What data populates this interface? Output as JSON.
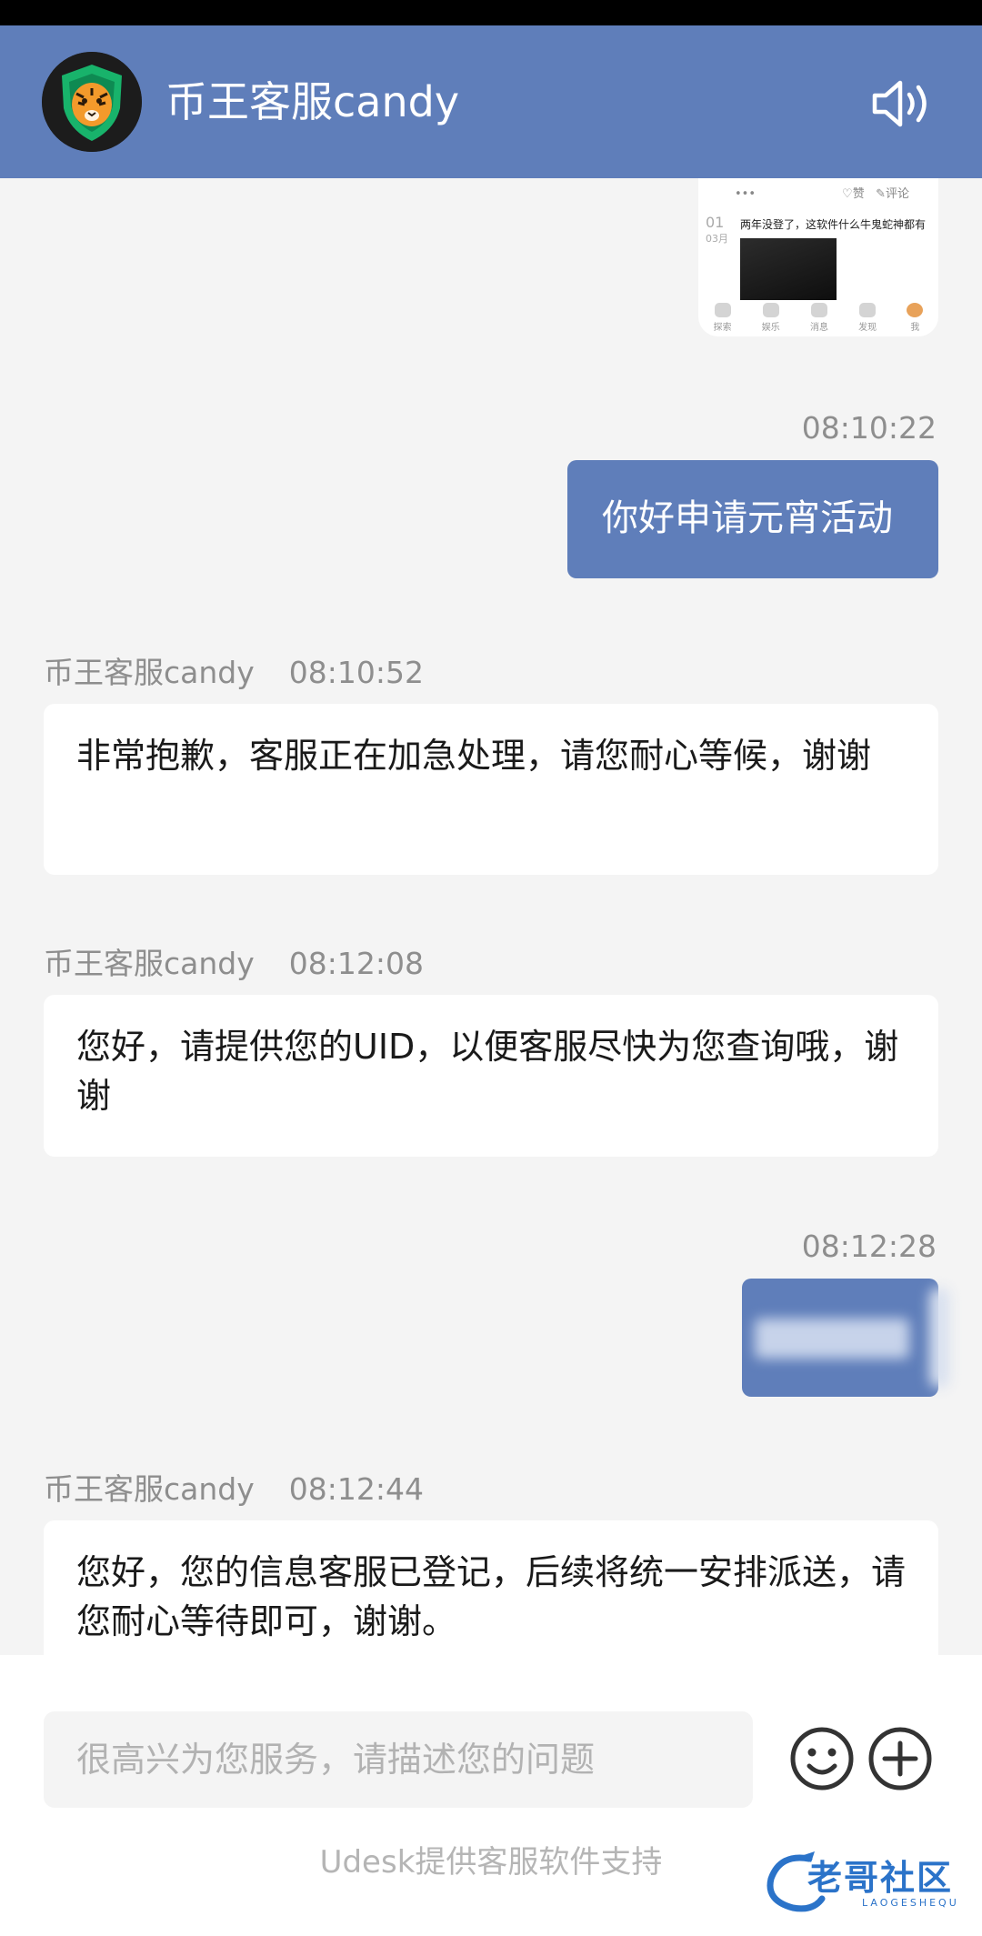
{
  "header": {
    "title": "币王客服candy",
    "avatar": "tiger-shield-avatar",
    "speaker_icon": "speaker-icon"
  },
  "shared_image": {
    "count_label": "赞",
    "comment_label": "评论",
    "date_day": "01",
    "date_month": "03月",
    "post_text": "两年没登了，这软件什么牛鬼蛇神都有",
    "nav": [
      "探索",
      "娱乐",
      "消息",
      "发现",
      "我"
    ]
  },
  "messages": [
    {
      "time": "08:10:22",
      "text": "你好申请元宵活动"
    },
    {
      "sender": "币王客服candy",
      "time": "08:10:52",
      "text": "非常抱歉，客服正在加急处理，请您耐心等候，谢谢"
    },
    {
      "sender": "币王客服candy",
      "time": "08:12:08",
      "text": "您好，请提供您的UID，以便客服尽快为您查询哦，谢谢"
    },
    {
      "time": "08:12:28"
    },
    {
      "sender": "币王客服candy",
      "time": "08:12:44",
      "text": "您好，您的信息客服已登记，后续将统一安排派送，请您耐心等待即可，谢谢。"
    }
  ],
  "composer": {
    "placeholder": "很高兴为您服务，请描述您的问题",
    "emoji_icon": "smiley-icon",
    "add_icon": "plus-circle-icon"
  },
  "footer": {
    "text": "Udesk提供客服软件支持"
  },
  "watermark": {
    "text": "老哥社区",
    "sub": "LAOGESHEQU"
  },
  "colors": {
    "brand": "#5f7eba",
    "background": "#f4f4f4"
  }
}
